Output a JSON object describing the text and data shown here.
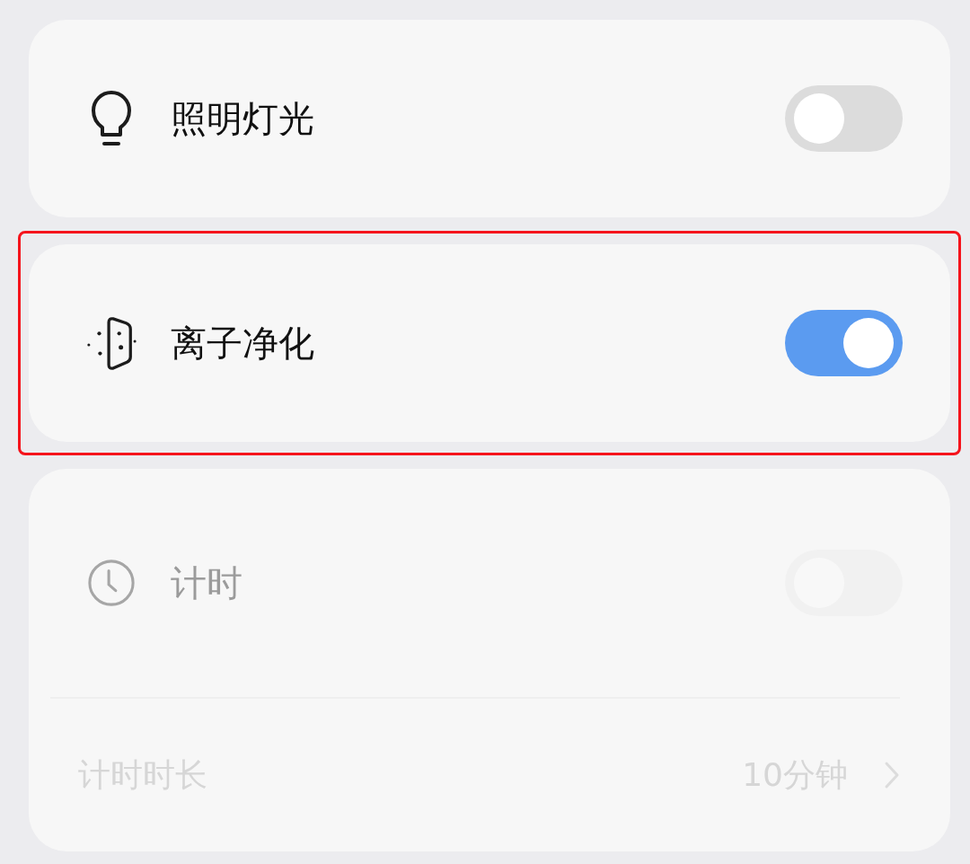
{
  "settings": [
    {
      "label": "照明灯光",
      "on": false,
      "disabled": false,
      "highlighted": false
    },
    {
      "label": "离子净化",
      "on": true,
      "disabled": false,
      "highlighted": true
    },
    {
      "label": "计时",
      "on": false,
      "disabled": true,
      "highlighted": false,
      "details": [
        {
          "label": "计时时长",
          "value": "10分钟"
        }
      ]
    }
  ]
}
